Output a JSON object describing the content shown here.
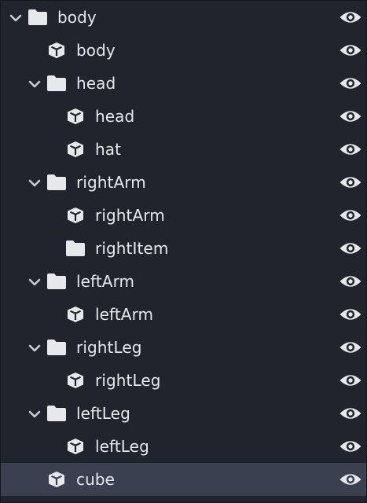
{
  "colors": {
    "background": "#21242c",
    "selected_row": "#3b4050",
    "text": "#e6e8ec",
    "icon": "#e6e8ec",
    "chevron": "#c9ccd3"
  },
  "tree": [
    {
      "id": "body-group",
      "label": "body",
      "type": "group",
      "depth": 0,
      "expanded": true,
      "selected": false,
      "visible": true
    },
    {
      "id": "body-cube",
      "label": "body",
      "type": "cube",
      "depth": 1,
      "selected": false,
      "visible": true
    },
    {
      "id": "head-group",
      "label": "head",
      "type": "group",
      "depth": 1,
      "expanded": true,
      "selected": false,
      "visible": true
    },
    {
      "id": "head-cube",
      "label": "head",
      "type": "cube",
      "depth": 2,
      "selected": false,
      "visible": true
    },
    {
      "id": "hat-cube",
      "label": "hat",
      "type": "cube",
      "depth": 2,
      "selected": false,
      "visible": true
    },
    {
      "id": "rightarm-group",
      "label": "rightArm",
      "type": "group",
      "depth": 1,
      "expanded": true,
      "selected": false,
      "visible": true
    },
    {
      "id": "rightarm-cube",
      "label": "rightArm",
      "type": "cube",
      "depth": 2,
      "selected": false,
      "visible": true
    },
    {
      "id": "rightitem-group",
      "label": "rightItem",
      "type": "group",
      "depth": 2,
      "expanded": false,
      "empty": true,
      "selected": false,
      "visible": true
    },
    {
      "id": "leftarm-group",
      "label": "leftArm",
      "type": "group",
      "depth": 1,
      "expanded": true,
      "selected": false,
      "visible": true
    },
    {
      "id": "leftarm-cube",
      "label": "leftArm",
      "type": "cube",
      "depth": 2,
      "selected": false,
      "visible": true
    },
    {
      "id": "rightleg-group",
      "label": "rightLeg",
      "type": "group",
      "depth": 1,
      "expanded": true,
      "selected": false,
      "visible": true
    },
    {
      "id": "rightleg-cube",
      "label": "rightLeg",
      "type": "cube",
      "depth": 2,
      "selected": false,
      "visible": true
    },
    {
      "id": "leftleg-group",
      "label": "leftLeg",
      "type": "group",
      "depth": 1,
      "expanded": true,
      "selected": false,
      "visible": true
    },
    {
      "id": "leftleg-cube",
      "label": "leftLeg",
      "type": "cube",
      "depth": 2,
      "selected": false,
      "visible": true
    },
    {
      "id": "cube-cube",
      "label": "cube",
      "type": "cube",
      "depth": 1,
      "selected": true,
      "visible": true
    }
  ]
}
